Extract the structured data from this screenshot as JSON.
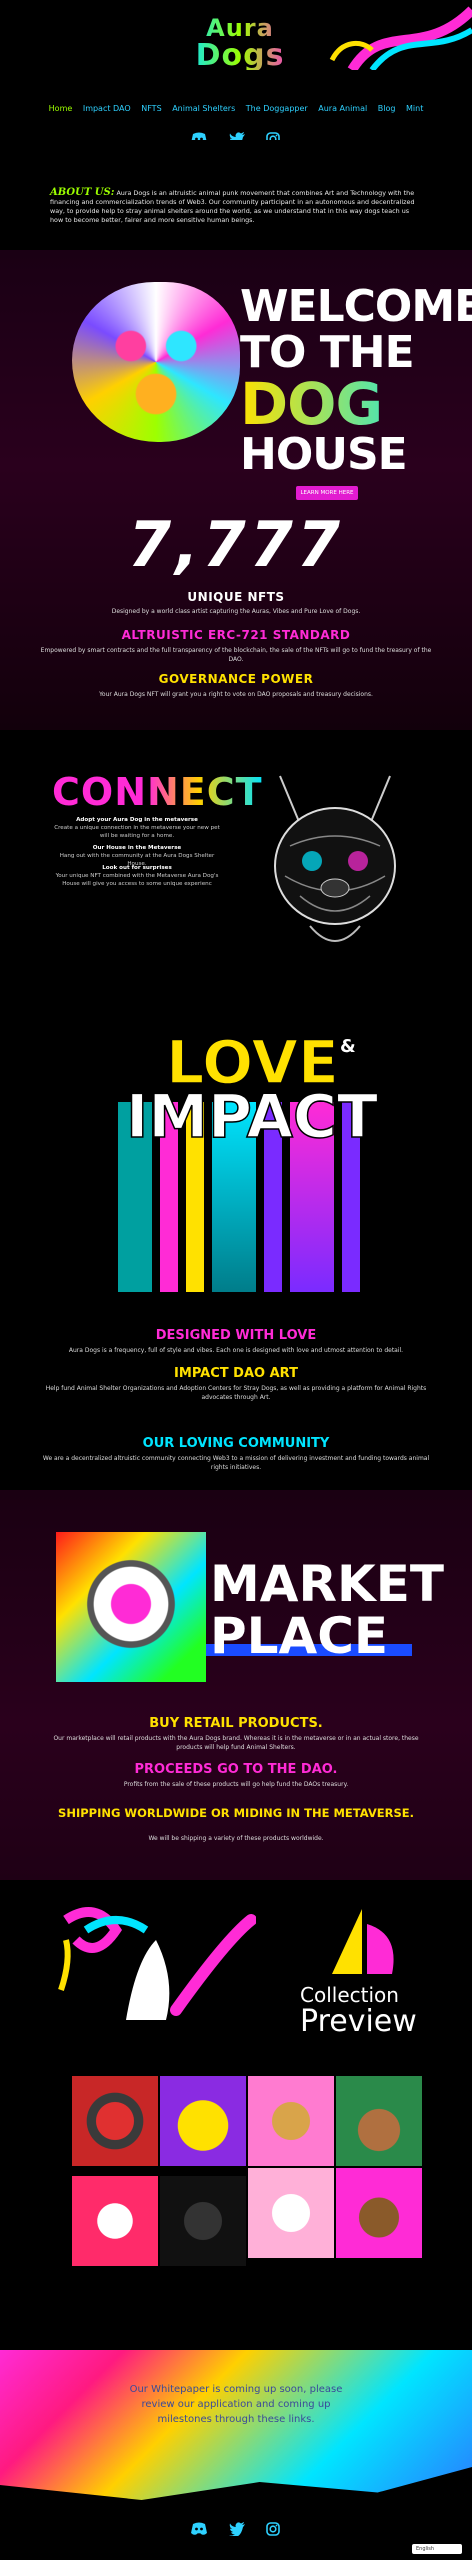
{
  "header": {
    "logo_line1": "Aura",
    "logo_line2": "Dogs",
    "nav": [
      "Home",
      "Impact DAO",
      "NFTS",
      "Animal Shelters",
      "The Doggapper",
      "Aura Animal",
      "Blog",
      "Mint"
    ],
    "social": [
      "discord-icon",
      "twitter-icon",
      "instagram-icon"
    ]
  },
  "about": {
    "heading": "ABOUT US:",
    "body": "Aura Dogs is an altruistic animal punk movement that combines Art and Technology with the financing and commercialization trends of Web3. Our community participant in an autonomous and decentralized way, to provide help to stray animal shelters around the world, as we understand that in this way dogs teach us how to become better, fairer and more sensitive human beings."
  },
  "welcome": {
    "line1": "WELCOME",
    "line2": "TO THE",
    "line3": "DOG",
    "line4": "HOUSE",
    "button": "LEARN MORE HERE",
    "count": "7,777",
    "unique_title": "UNIQUE NFTS",
    "unique_text": "Designed by a world class artist capturing the Auras, Vibes and Pure Love of Dogs.",
    "erc_title": "ALTRUISTIC ERC-721 STANDARD",
    "erc_text": "Empowered by smart contracts and the full transparency of the blockchain, the sale of the NFTs will go to fund the treasury of the DAO.",
    "gov_title": "GOVERNANCE POWER",
    "gov_text": "Your Aura Dogs NFT will grant you a right to vote on DAO proposals and treasury decisions."
  },
  "connect": {
    "title": "CONNECT",
    "items": [
      {
        "title": "Adopt your Aura Dog in the metaverse",
        "text": "Create a unique connection in the metaverse your new pet will be waiting for a home."
      },
      {
        "title": "Our House in the Metaverse",
        "text": "Hang out with the community at the Aura Dogs Shelter House."
      },
      {
        "title": "Look out for surprises",
        "text": "Your unique NFT combined with the Metaverse Aura Dog's House will give you access to some unique experienc"
      }
    ]
  },
  "love": {
    "title_love": "LOVE",
    "amp": "&",
    "title_impact": "IMPACT",
    "designed_title": "DESIGNED WITH LOVE",
    "designed_text": "Aura Dogs is a frequency, full of style and vibes. Each one is designed with love and utmost attention to detail.",
    "dao_title": "IMPACT DAO ART",
    "dao_text": "Help fund Animal Shelter Organizations and Adoption Centers for Stray Dogs, as well as providing a platform for Animal Rights advocates through Art.",
    "community_title": "OUR LOVING COMMUNITY",
    "community_text": "We are a decentralized altruistic community connecting Web3 to a mission of delivering investment and funding towards animal rights initiatives."
  },
  "market": {
    "line1": "MARKET",
    "line2": "PLACE",
    "retail_title": "BUY RETAIL PRODUCTS.",
    "retail_text": "Our marketplace will retail products with the Aura Dogs brand. Whereas it is in the metaverse or in an actual store, these products will help fund Animal Shelters.",
    "proceeds_title": "PROCEEDS GO TO THE DAO.",
    "proceeds_text": "Profits from the sale of these products will go help fund the DAOs treasury.",
    "shipping_title": "SHIPPING WORLDWIDE OR MIDING IN THE METAVERSE.",
    "shipping_text": "We will be shipping a variety of these products worldwide."
  },
  "collection": {
    "line1": "Collection",
    "line2": "Preview"
  },
  "footer": {
    "whitepaper": "Our Whitepaper is coming up soon, please review our application and coming up milestones through these links.",
    "lang": "English"
  },
  "colors": {
    "magenta": "#e21bd0",
    "lime": "#9dff00",
    "cyan": "#00e5ff",
    "yellow": "#ffe100"
  }
}
